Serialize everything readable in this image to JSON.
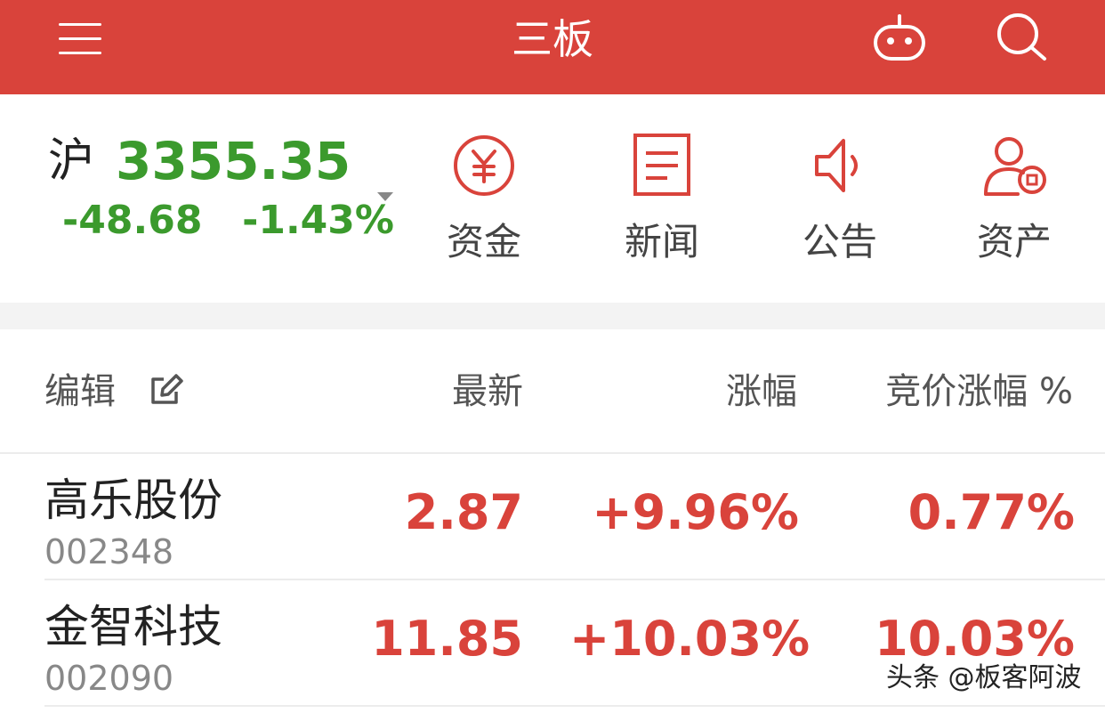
{
  "header": {
    "title": "三板",
    "menu_icon": "menu-icon",
    "robot_icon": "robot-icon",
    "search_icon": "search-icon"
  },
  "index": {
    "name": "沪",
    "value": "3355.35",
    "change": "-48.68",
    "change_pct": "-1.43%",
    "color": "#3b9a2d"
  },
  "quick_actions": [
    {
      "label": "资金",
      "icon": "yuan-icon"
    },
    {
      "label": "新闻",
      "icon": "document-icon"
    },
    {
      "label": "公告",
      "icon": "speaker-icon"
    },
    {
      "label": "资产",
      "icon": "user-assets-icon"
    }
  ],
  "table": {
    "columns": [
      "编辑",
      "最新",
      "涨幅",
      "竞价涨幅 %"
    ],
    "rows": [
      {
        "name": "高乐股份",
        "code": "002348",
        "latest": "2.87",
        "change": "+9.96%",
        "auction": "0.77%"
      },
      {
        "name": "金智科技",
        "code": "002090",
        "latest": "11.85",
        "change": "+10.03%",
        "auction": "10.03%"
      }
    ]
  },
  "watermark": "头条 @板客阿波",
  "colors": {
    "brand": "#d9433b",
    "up": "#d9433b",
    "down": "#3b9a2d"
  }
}
